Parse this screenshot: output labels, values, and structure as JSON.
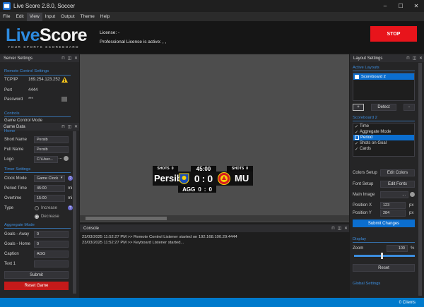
{
  "window": {
    "title": "Live Score 2.8.0, Soccer",
    "controls": [
      "–",
      "☐",
      "✕"
    ]
  },
  "menu": [
    "File",
    "Edit",
    "View",
    "Input",
    "Output",
    "Theme",
    "Help"
  ],
  "header": {
    "logo_a": "Live",
    "logo_b": "Score",
    "tagline": "YOUR SPORTS SCOREBOARD",
    "license_label": "License: -",
    "license_status": "Professional License is active: , ,",
    "stop_label": "STOP",
    "colors": {
      "accent": "#2d8be0",
      "stop": "#e8141b"
    }
  },
  "server_settings": {
    "title": "Server Settings",
    "section": "Remote Control Settings",
    "tcpip_label": "TCP/IP",
    "tcpip_value": "169.254.123.252",
    "port_label": "Port",
    "port_value": "4444",
    "password_label": "Password",
    "password_value": "***",
    "controls_section": "Controls",
    "game_control_mode": "Game Control Mode"
  },
  "game_data": {
    "title": "Game Data",
    "home_section": "Home",
    "short_name_label": "Short Name",
    "short_name_value": "Persib",
    "full_name_label": "Full Name",
    "full_name_value": "Persib",
    "logo_label": "Logo",
    "logo_value": "C:\\User...",
    "logo_browse": "...",
    "timer_section": "Timer Settings",
    "clock_mode_label": "Clock Mode",
    "clock_mode_value": "Game Clock",
    "period_time_label": "Period Time",
    "period_time_value": "45:00",
    "period_time_unit": "mi",
    "overtime_label": "Overtime",
    "overtime_value": "15:00",
    "overtime_unit": "mi",
    "type_label": "Type",
    "increase_label": "Increase",
    "decrease_label": "Decrease",
    "aggregate_section": "Aggregate Mode",
    "goals_away_label": "Goals - Away",
    "goals_away_value": "0",
    "goals_home_label": "Goals - Home",
    "goals_home_value": "0",
    "caption_label": "Caption",
    "caption_value": "AGG",
    "text1_label": "Text 1",
    "text1_value": "",
    "submit_label": "Submit",
    "reset_label": "Reset Game"
  },
  "scoreboard": {
    "shots_label_left": "SHOTS",
    "shots_left": "0",
    "shots_label_right": "SHOTS",
    "shots_right": "0",
    "clock": "45:00",
    "home_name": "Persib",
    "away_name": "MU",
    "home_score": "0",
    "away_score": "0",
    "score_separator": ":",
    "agg_label": "AGG",
    "agg_home": "0",
    "agg_away": "0",
    "agg_separator": ":"
  },
  "console": {
    "title": "Console",
    "lines": [
      "23/03/2025 11:52:27 PM >> Remote Control Listener started on 192.168.100.29:4444",
      "23/03/2025 11:52:27 PM >> Keyboard Listener started..."
    ]
  },
  "layout_settings": {
    "title": "Layout Settings",
    "active_layouts_section": "Active Layouts",
    "layouts": [
      "Scoreboard 2"
    ],
    "add_button": "+",
    "detect_button": "Detect",
    "remove_button": "-",
    "scoreboard_section": "Scoreboard 2",
    "elements": [
      {
        "label": "Time",
        "checked": true
      },
      {
        "label": "Aggregate Mode",
        "checked": true
      },
      {
        "label": "Period",
        "checked": false
      },
      {
        "label": "Shots on Goal",
        "checked": true
      },
      {
        "label": "Cards",
        "checked": true
      }
    ],
    "colors_setup_label": "Colors Setup",
    "edit_colors_button": "Edit Colors",
    "font_setup_label": "Font Setup",
    "edit_fonts_button": "Edit Fonts",
    "main_image_label": "Main Image",
    "main_image_browse": "...",
    "position_x_label": "Position X",
    "position_x_value": "123",
    "position_y_label": "Position Y",
    "position_y_value": "284",
    "px_unit": "px",
    "submit_changes_button": "Submit Changes",
    "display_section": "Display",
    "zoom_label": "Zoom",
    "zoom_value": "100",
    "zoom_unit": "%",
    "reset_button": "Reset",
    "global_section": "Global Settings"
  },
  "status": {
    "clients": "0 Clients"
  }
}
